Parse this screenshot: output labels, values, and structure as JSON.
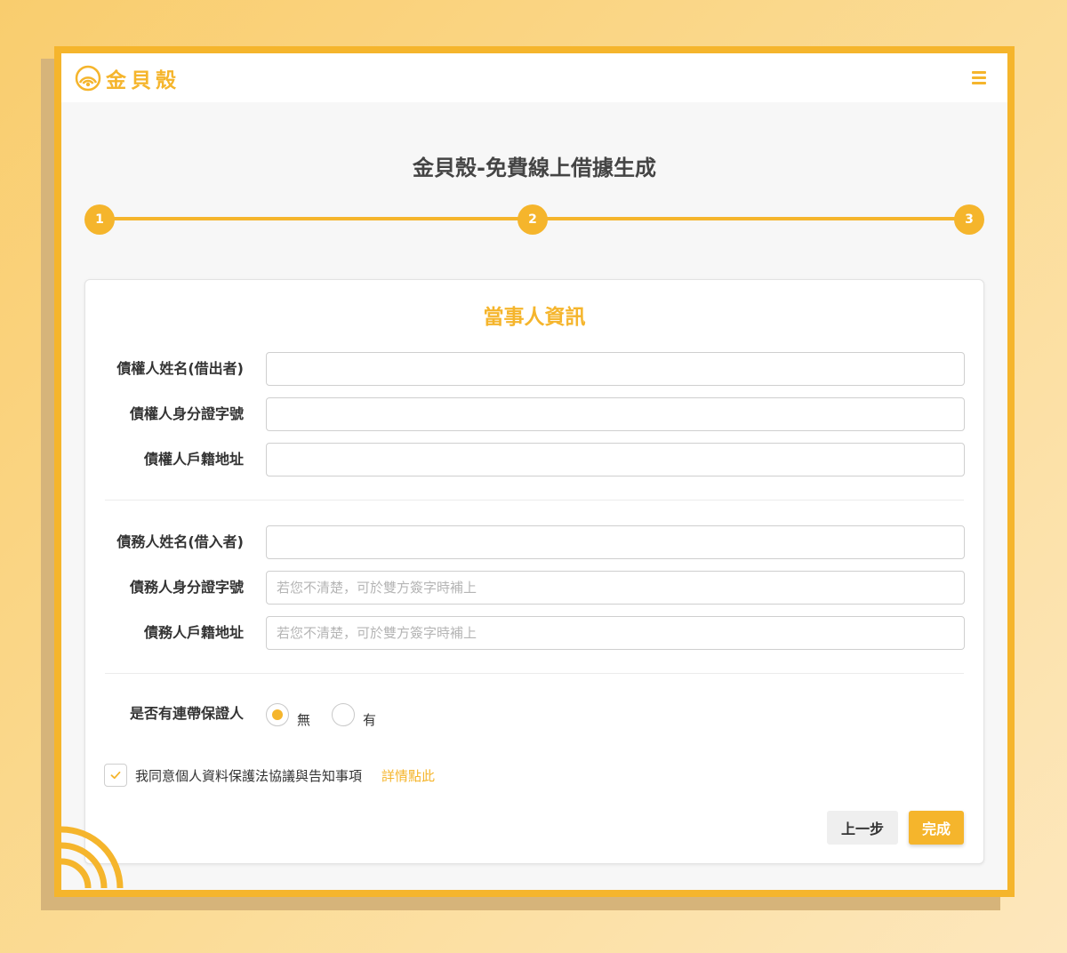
{
  "header": {
    "brand": "金貝殼",
    "logo_icon": "shell-icon",
    "menu_icon": "hamburger-menu-icon"
  },
  "page_title": "金貝殼-免費線上借據生成",
  "stepper": {
    "steps": [
      "1",
      "2",
      "3"
    ],
    "current_step": 3
  },
  "form": {
    "title": "當事人資訊",
    "creditor": {
      "name_label": "債權人姓名(借出者)",
      "name_value": "",
      "id_label": "債權人身分證字號",
      "id_value": "",
      "address_label": "債權人戶籍地址",
      "address_value": ""
    },
    "debtor": {
      "name_label": "債務人姓名(借入者)",
      "name_value": "",
      "id_label": "債務人身分證字號",
      "id_placeholder": "若您不清楚，可於雙方簽字時補上",
      "address_label": "債務人戶籍地址",
      "address_placeholder": "若您不清楚，可於雙方簽字時補上"
    },
    "guarantor": {
      "label": "是否有連帶保證人",
      "options": [
        "無",
        "有"
      ],
      "selected": "無"
    },
    "agreement": {
      "checked": true,
      "text": "我同意個人資料保護法協議與告知事項",
      "link": "詳情點此"
    },
    "buttons": {
      "prev": "上一步",
      "done": "完成"
    }
  },
  "colors": {
    "accent": "#f5b52c",
    "background_light": "#f7f7f7",
    "text_dark": "#333333"
  }
}
